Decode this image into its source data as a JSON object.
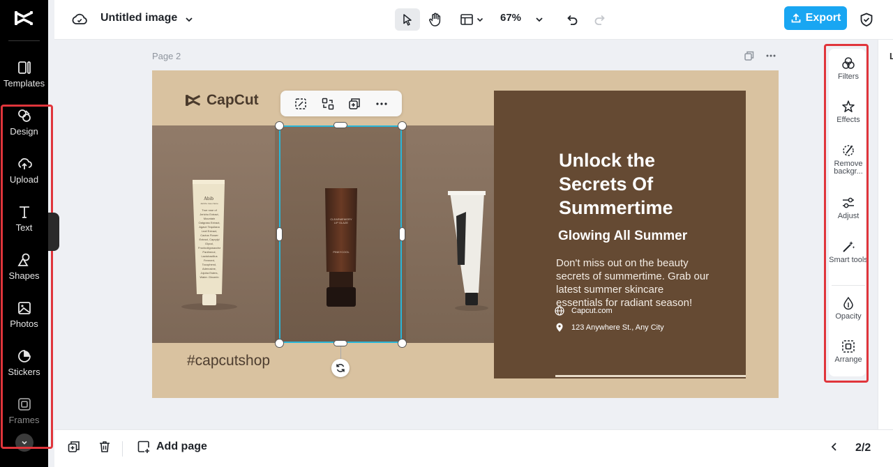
{
  "app": {
    "document_title": "Untitled image",
    "zoom": "67%"
  },
  "toolbar": {
    "export_label": "Export"
  },
  "sidebar": {
    "items": [
      {
        "label": "Templates",
        "icon": "templates-icon"
      },
      {
        "label": "Design",
        "icon": "design-icon"
      },
      {
        "label": "Upload",
        "icon": "upload-icon"
      },
      {
        "label": "Text",
        "icon": "text-icon"
      },
      {
        "label": "Shapes",
        "icon": "shapes-icon"
      },
      {
        "label": "Photos",
        "icon": "photos-icon"
      },
      {
        "label": "Stickers",
        "icon": "stickers-icon"
      },
      {
        "label": "Frames",
        "icon": "frames-icon"
      }
    ]
  },
  "canvas": {
    "page_label": "Page 2",
    "brand_name": "CapCut",
    "hashtag": "#capcutshop",
    "headline": "Unlock the Secrets Of Summertime",
    "subheadline": "Glowing All Summer",
    "body": "Don't miss out on the beauty secrets of summertime. Grab our latest summer skincare essentials for radiant season!",
    "website": "Capcut.com",
    "address": "123 Anywhere St., Any City",
    "products": {
      "a_brand": "Abib",
      "a_subtitle": "Jericho rose crème",
      "a_ingredients": "True rose of Jericho Extract, Mountain Oatgrass Extract, Agave Tequilana Leaf Extract, Cactus Flower Extract, Caprylyl Glycol, Fructooligosaccharides, Panthenol, Lactobacillus Ferment, Tocopherol, Adenosine, Jojoba Esters, Water, Glycerin",
      "b_label": "CLEARMEMORY LIP GLAZE",
      "b_brand": "PINKYCOOL"
    }
  },
  "right_tools": [
    {
      "label": "Filters",
      "icon": "filters-icon"
    },
    {
      "label": "Effects",
      "icon": "effects-icon"
    },
    {
      "label": "Remove backgr...",
      "icon": "remove-background-icon"
    },
    {
      "label": "Adjust",
      "icon": "adjust-icon"
    },
    {
      "label": "Smart tools",
      "icon": "smart-tools-icon"
    },
    {
      "label": "Opacity",
      "icon": "opacity-icon"
    },
    {
      "label": "Arrange",
      "icon": "arrange-icon"
    }
  ],
  "right_strip": {
    "letter": "L"
  },
  "bottom": {
    "add_page_label": "Add page",
    "page_count": "2/2"
  },
  "colors": {
    "accent": "#19a6f2",
    "highlight_box": "#e0353b",
    "selection": "#29b6d8",
    "canvas_bg": "#d9c2a0",
    "panel_bg": "#654a33"
  }
}
